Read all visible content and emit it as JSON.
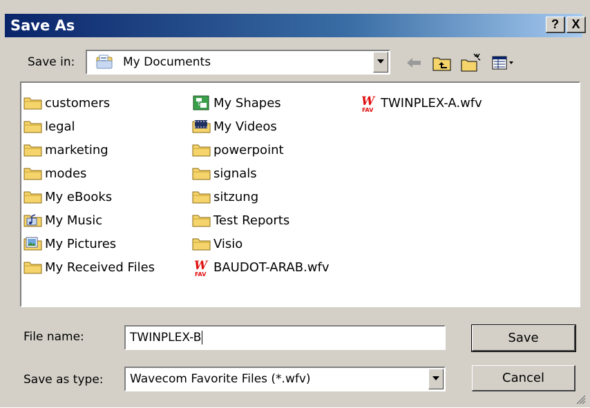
{
  "window": {
    "title": "Save As"
  },
  "titlebar_buttons": {
    "help": "?",
    "close": "X"
  },
  "toolbar": {
    "save_in_label": "Save in:",
    "save_in_value": "My Documents",
    "icons": [
      "back-arrow-icon",
      "up-folder-icon",
      "new-folder-icon",
      "view-menu-icon"
    ]
  },
  "files": {
    "col1": [
      {
        "name": "customers",
        "icon": "folder-icon"
      },
      {
        "name": "legal",
        "icon": "folder-icon"
      },
      {
        "name": "marketing",
        "icon": "folder-icon"
      },
      {
        "name": "modes",
        "icon": "folder-icon"
      },
      {
        "name": "My eBooks",
        "icon": "folder-icon"
      },
      {
        "name": "My Music",
        "icon": "music-folder-icon"
      },
      {
        "name": "My Pictures",
        "icon": "pictures-folder-icon"
      },
      {
        "name": "My Received Files",
        "icon": "folder-icon"
      }
    ],
    "col2": [
      {
        "name": "My Shapes",
        "icon": "shapes-folder-icon"
      },
      {
        "name": "My Videos",
        "icon": "videos-folder-icon"
      },
      {
        "name": "powerpoint",
        "icon": "folder-icon"
      },
      {
        "name": "signals",
        "icon": "folder-icon"
      },
      {
        "name": "sitzung",
        "icon": "folder-icon"
      },
      {
        "name": "Test Reports",
        "icon": "folder-icon"
      },
      {
        "name": "Visio",
        "icon": "folder-icon"
      },
      {
        "name": "BAUDOT-ARAB.wfv",
        "icon": "wfv-file-icon"
      }
    ],
    "col3": [
      {
        "name": "TWINPLEX-A.wfv",
        "icon": "wfv-file-icon"
      }
    ]
  },
  "form": {
    "file_name_label": "File name:",
    "file_name_value": "TWINPLEX-B",
    "save_as_type_label": "Save as type:",
    "save_as_type_value": "Wavecom Favorite Files (*.wfv)"
  },
  "buttons": {
    "save": "Save",
    "cancel": "Cancel"
  },
  "colors": {
    "title_start": "#0a246a",
    "title_end": "#a6caf0",
    "face": "#d4d0c8",
    "folder": "#f5d46b"
  }
}
